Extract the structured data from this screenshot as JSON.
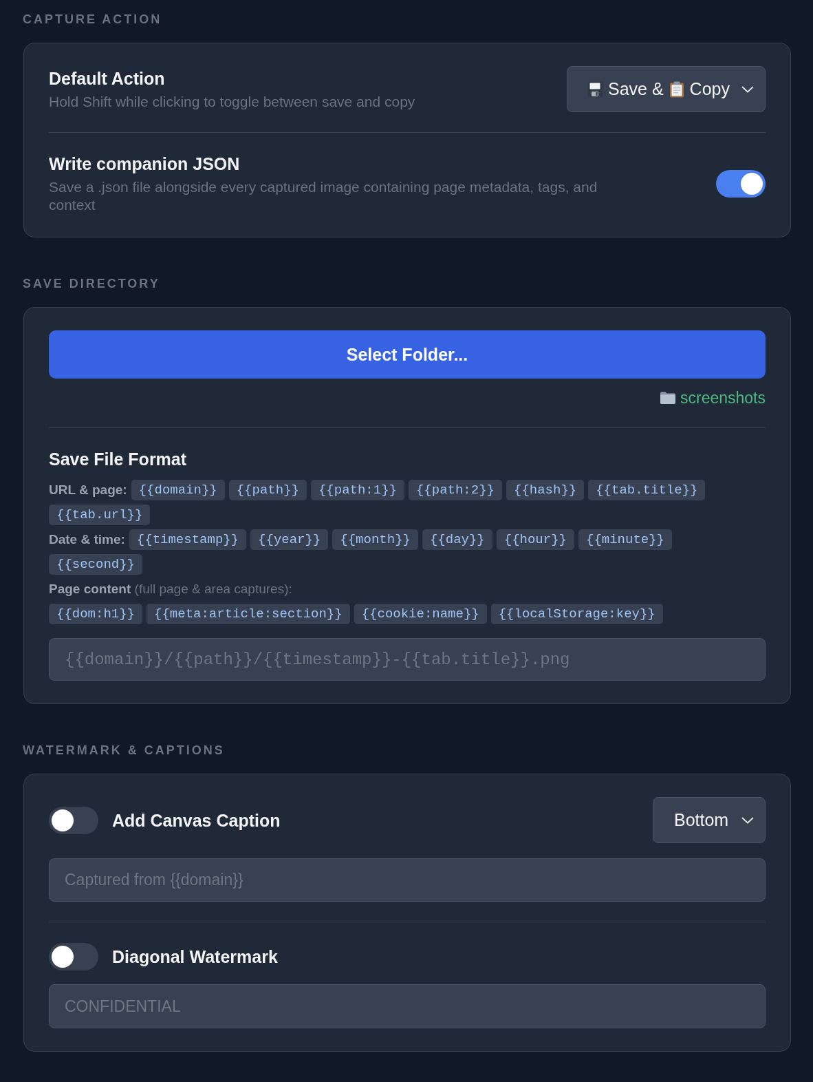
{
  "capture_action": {
    "title": "CAPTURE ACTION",
    "default_action": {
      "label": "Default Action",
      "description": "Hold Shift while clicking to toggle between save and copy",
      "dropdown": [
        {
          "kind": "floppy",
          "text": "Save &"
        },
        {
          "kind": "clipboard",
          "text": "Copy"
        }
      ]
    },
    "companion_json": {
      "label": "Write companion JSON",
      "description": "Save a .json file alongside every captured image containing page metadata, tags, and context",
      "on": true
    }
  },
  "save_directory": {
    "title": "SAVE DIRECTORY",
    "button": "Select Folder...",
    "folder": "screenshots",
    "format": {
      "title": "Save File Format",
      "groups": [
        {
          "kind": "inline",
          "label": "URL & page:",
          "tokens": [
            "{{domain}}",
            "{{path}}",
            "{{path:1}}",
            "{{path:2}}",
            "{{hash}}",
            "{{tab.title}}",
            "{{tab.url}}"
          ]
        },
        {
          "kind": "inline",
          "label": "Date & time:",
          "tokens": [
            "{{timestamp}}",
            "{{year}}",
            "{{month}}",
            "{{day}}",
            "{{hour}}",
            "{{minute}}",
            "{{second}}"
          ]
        },
        {
          "kind": "stacked",
          "label": "**Page content** (full page & area captures):",
          "tokens": [
            "{{dom:h1}}",
            "{{meta:article:section}}",
            "{{cookie:name}}",
            "{{localStorage:key}}"
          ]
        }
      ],
      "placeholder": "{{domain}}/{{path}}/{{timestamp}}-{{tab.title}}.png"
    }
  },
  "watermark": {
    "title": "WATERMARK & CAPTIONS",
    "caption": {
      "label": "Add Canvas Caption",
      "on": false,
      "position": "Bottom",
      "placeholder": "Captured from {{domain}}"
    },
    "diagonal": {
      "label": "Diagonal Watermark",
      "on": false,
      "placeholder": "CONFIDENTIAL"
    }
  }
}
